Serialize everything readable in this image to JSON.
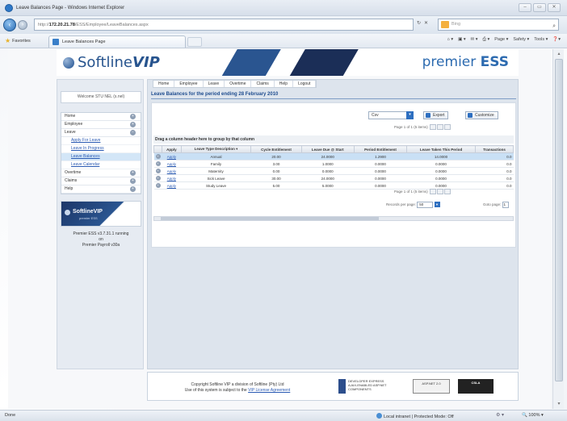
{
  "window": {
    "title": "Leave Balances Page - Windows Internet Explorer",
    "buttons": [
      "–",
      "▭",
      "✕"
    ]
  },
  "address": {
    "prefix": "http://",
    "host": "172.20.21.78",
    "path": "/ESS/Employee/LeaveBalances.aspx",
    "search_placeholder": "Bing"
  },
  "favorites": {
    "label": "Favorites",
    "tab_title": "Leave Balances Page",
    "commands": [
      "Page ▾",
      "Safety ▾",
      "Tools ▾",
      "❓▾"
    ]
  },
  "banner": {
    "logo_text": "Softline",
    "logo_suffix": "VIP",
    "brand_left": "premier",
    "brand_right": "ESS"
  },
  "sidebar": {
    "welcome": "Welcome STU NEL (s.nel)",
    "menu": [
      {
        "label": "Home",
        "type": "item"
      },
      {
        "label": "Employee",
        "type": "item"
      },
      {
        "label": "Leave",
        "type": "item"
      },
      {
        "label": "Apply For Leave",
        "type": "sub"
      },
      {
        "label": "Leave In Progress",
        "type": "sub"
      },
      {
        "label": "Leave Balances",
        "type": "sub",
        "active": true
      },
      {
        "label": "Leave Calendar",
        "type": "sub"
      },
      {
        "label": "Overtime",
        "type": "item"
      },
      {
        "label": "Claims",
        "type": "item"
      },
      {
        "label": "Help",
        "type": "item"
      }
    ],
    "logo_text": "SoftlineVIP",
    "logo_sub": "premier ESS",
    "version_line1": "Premier ESS v3.7.31.1 running",
    "version_line2": "on",
    "version_line3": "Premier Payroll v30a"
  },
  "topnav": [
    "Home",
    "Employee",
    "Leave",
    "Overtime",
    "Claims",
    "Help",
    "Logout"
  ],
  "main": {
    "period_title": "Leave Balances for the period ending 28 February 2010",
    "export_format": "Csv",
    "export_label": "Export",
    "customize_label": "Customize",
    "pager_top": "Page 1 of 1 (5 items)",
    "pager_bottom": "Page 1 of 1 (5 items)",
    "group_hint": "Drag a column header here to group by that column",
    "records_label": "Records per page:",
    "records_value": "50",
    "goto_label": "Goto page:",
    "goto_value": "1"
  },
  "grid": {
    "columns": [
      "",
      "Apply",
      "Leave Type Description ▾",
      "Cycle Entitlement",
      "Leave Due @ Start",
      "Period Entitlement",
      "Leave Taken This Period",
      "Transactions"
    ],
    "rows": [
      [
        "Apply",
        "Annual",
        "20.00",
        "24.0000",
        "1.2900",
        "14.0000",
        "0.0"
      ],
      [
        "Apply",
        "Family",
        "3.00",
        "1.0000",
        "0.0000",
        "0.0000",
        "0.0"
      ],
      [
        "Apply",
        "Maternity",
        "0.00",
        "0.0000",
        "0.0000",
        "0.0000",
        "0.0"
      ],
      [
        "Apply",
        "Sick Leave",
        "30.00",
        "24.0000",
        "0.0000",
        "0.0000",
        "0.0"
      ],
      [
        "Apply",
        "Study Leave",
        "5.00",
        "5.0000",
        "0.0000",
        "0.0000",
        "0.0"
      ]
    ],
    "selected_row": 0
  },
  "footer": {
    "copyright": "Copyright Softline VIP a division of Softline (Pty) Ltd",
    "license_prefix": "Use of this system is subject to the",
    "license_link": "VIP License Agreement",
    "dx_line1": "DEVELOPER EXPRESS",
    "dx_line2": "AJAX-ENABLED ASP.NET",
    "dx_line3": "COMPONENTS",
    "asp_badge": "ASP.NET 2.0",
    "csla_badge": "CSLA"
  },
  "status": {
    "left": "Done",
    "zone": "Local intranet | Protected Mode: Off",
    "zoom": "100% ▾"
  }
}
